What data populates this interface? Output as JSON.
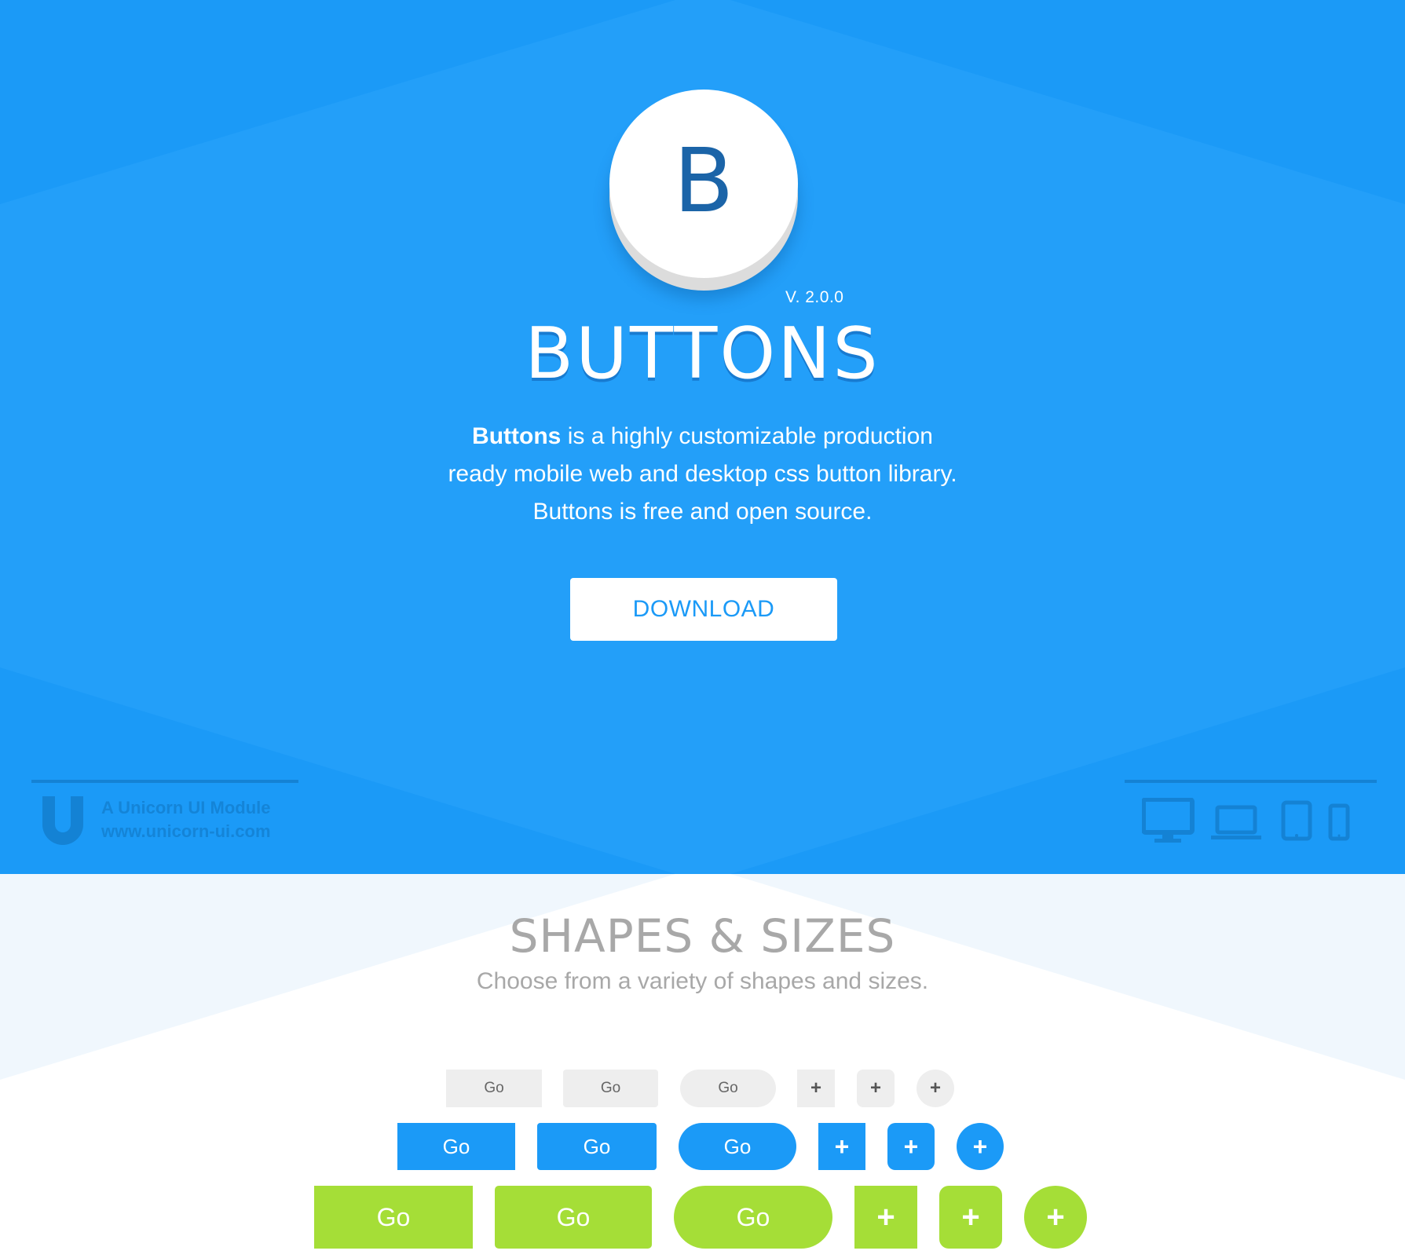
{
  "hero": {
    "logo_letter": "B",
    "version": "V. 2.0.0",
    "title": "BUTTONS",
    "desc_bold": "Buttons",
    "desc_rest": " is a highly customizable production ready mobile web and desktop css button library. Buttons is free and open source.",
    "download_label": "DOWNLOAD",
    "credit_line1": "A Unicorn UI Module",
    "credit_line2": "www.unicorn-ui.com",
    "device_icons": [
      "desktop-icon",
      "laptop-icon",
      "tablet-icon",
      "phone-icon"
    ]
  },
  "shapes": {
    "title": "SHAPES & SIZES",
    "subtitle": "Choose from a variety of shapes and sizes.",
    "go_label": "Go",
    "plus_label": "+",
    "rows": [
      {
        "size": "small",
        "color": "#eeeeee"
      },
      {
        "size": "medium",
        "color": "#1b9af7"
      },
      {
        "size": "large",
        "color": "#a5de37"
      }
    ]
  },
  "colors": {
    "primary": "#1b9af7",
    "action": "#a5de37",
    "default": "#eeeeee",
    "logo_letter": "#1b64a8"
  }
}
